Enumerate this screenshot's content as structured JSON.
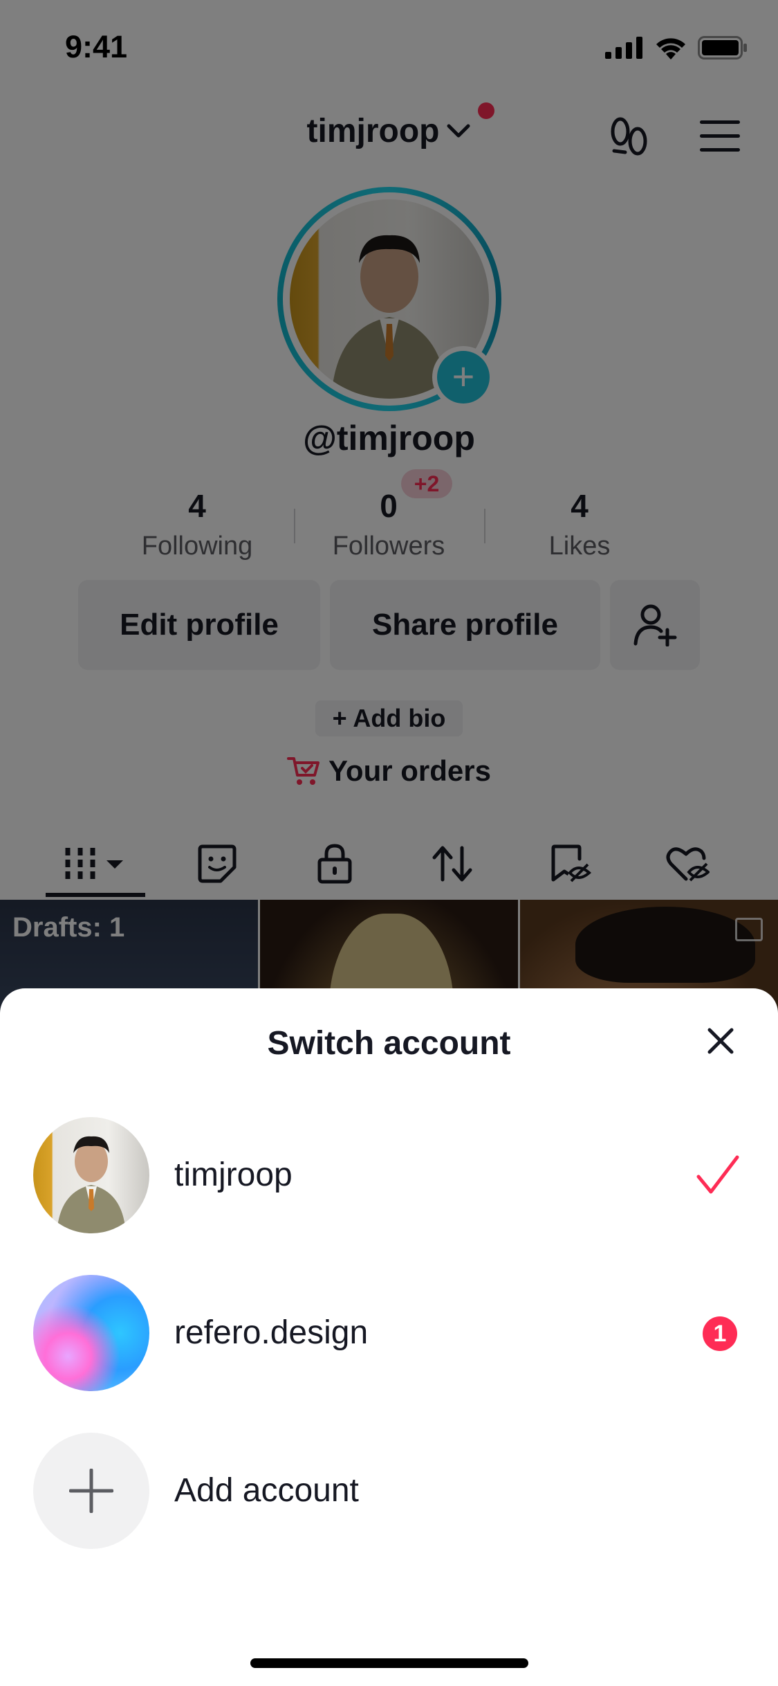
{
  "status_bar": {
    "time": "9:41"
  },
  "header": {
    "username": "timjroop"
  },
  "profile": {
    "handle": "@timjroop"
  },
  "stats": [
    {
      "value": "4",
      "label": "Following"
    },
    {
      "value": "0",
      "label": "Followers",
      "badge": "+2"
    },
    {
      "value": "4",
      "label": "Likes"
    }
  ],
  "buttons": {
    "edit": "Edit profile",
    "share": "Share profile"
  },
  "bio": {
    "add_label": "+ Add bio"
  },
  "orders": {
    "label": "Your orders"
  },
  "grid": {
    "drafts_label": "Drafts: 1"
  },
  "sheet": {
    "title": "Switch account",
    "accounts": [
      {
        "name": "timjroop",
        "selected": true
      },
      {
        "name": "refero.design",
        "notifications": "1"
      }
    ],
    "add_label": "Add account"
  },
  "colors": {
    "brand_red": "#fe2c55",
    "accent_teal": "#20c0d8"
  }
}
